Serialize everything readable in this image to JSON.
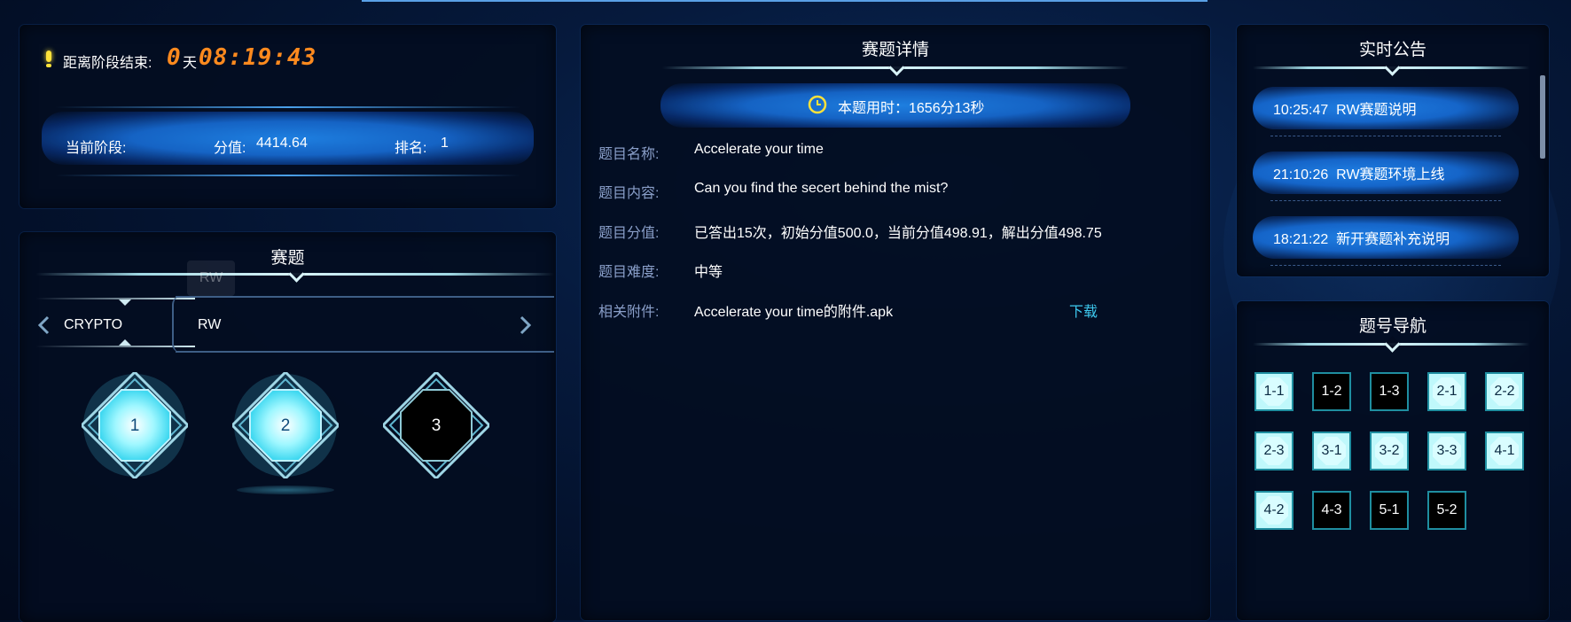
{
  "countdown": {
    "label": "距离阶段结束:",
    "days": "0",
    "day_unit": "天",
    "time": "08:19:43"
  },
  "stage": {
    "current_label": "当前阶段:",
    "score_label": "分值:",
    "score": "4414.64",
    "rank_label": "排名:",
    "rank": "1"
  },
  "challenges": {
    "title": "赛题",
    "tabs": [
      "CRYPTO",
      "RW"
    ],
    "active_tab": "RW",
    "tooltip": "RW",
    "items": [
      {
        "label": "1",
        "state": "solved"
      },
      {
        "label": "2",
        "state": "solved"
      },
      {
        "label": "3",
        "state": "open"
      }
    ]
  },
  "detail": {
    "title": "赛题详情",
    "time_used": "本题用时：1656分13秒",
    "fields": [
      {
        "label": "题目名称:",
        "value": "Accelerate your time"
      },
      {
        "label": "题目内容:",
        "value": "Can you find the secert behind the mist?"
      },
      {
        "label": "题目分值:",
        "value": "已答出15次，初始分值500.0，当前分值498.91，解出分值498.75"
      },
      {
        "label": "题目难度:",
        "value": "中等"
      },
      {
        "label": "相关附件:",
        "value": "Accelerate your time的附件.apk"
      }
    ],
    "download_label": "下载"
  },
  "announcements": {
    "title": "实时公告",
    "items": [
      {
        "time": "10:25:47",
        "text": "RW赛题说明"
      },
      {
        "time": "21:10:26",
        "text": "RW赛题环境上线"
      },
      {
        "time": "18:21:22",
        "text": "新开赛题补充说明"
      }
    ]
  },
  "nav": {
    "title": "题号导航",
    "items": [
      {
        "label": "1-1",
        "state": "solved"
      },
      {
        "label": "1-2",
        "state": "open"
      },
      {
        "label": "1-3",
        "state": "open"
      },
      {
        "label": "2-1",
        "state": "solved"
      },
      {
        "label": "2-2",
        "state": "solved"
      },
      {
        "label": "2-3",
        "state": "solved"
      },
      {
        "label": "3-1",
        "state": "solved"
      },
      {
        "label": "3-2",
        "state": "solved"
      },
      {
        "label": "3-3",
        "state": "solved"
      },
      {
        "label": "4-1",
        "state": "solved"
      },
      {
        "label": "4-2",
        "state": "solved"
      },
      {
        "label": "4-3",
        "state": "open"
      },
      {
        "label": "5-1",
        "state": "open"
      },
      {
        "label": "5-2",
        "state": "open"
      }
    ]
  },
  "colors": {
    "accent": "#1f7fe3",
    "digital": "#ff8a1e",
    "download": "#3ec9ef",
    "solved": "#bff8fb"
  }
}
